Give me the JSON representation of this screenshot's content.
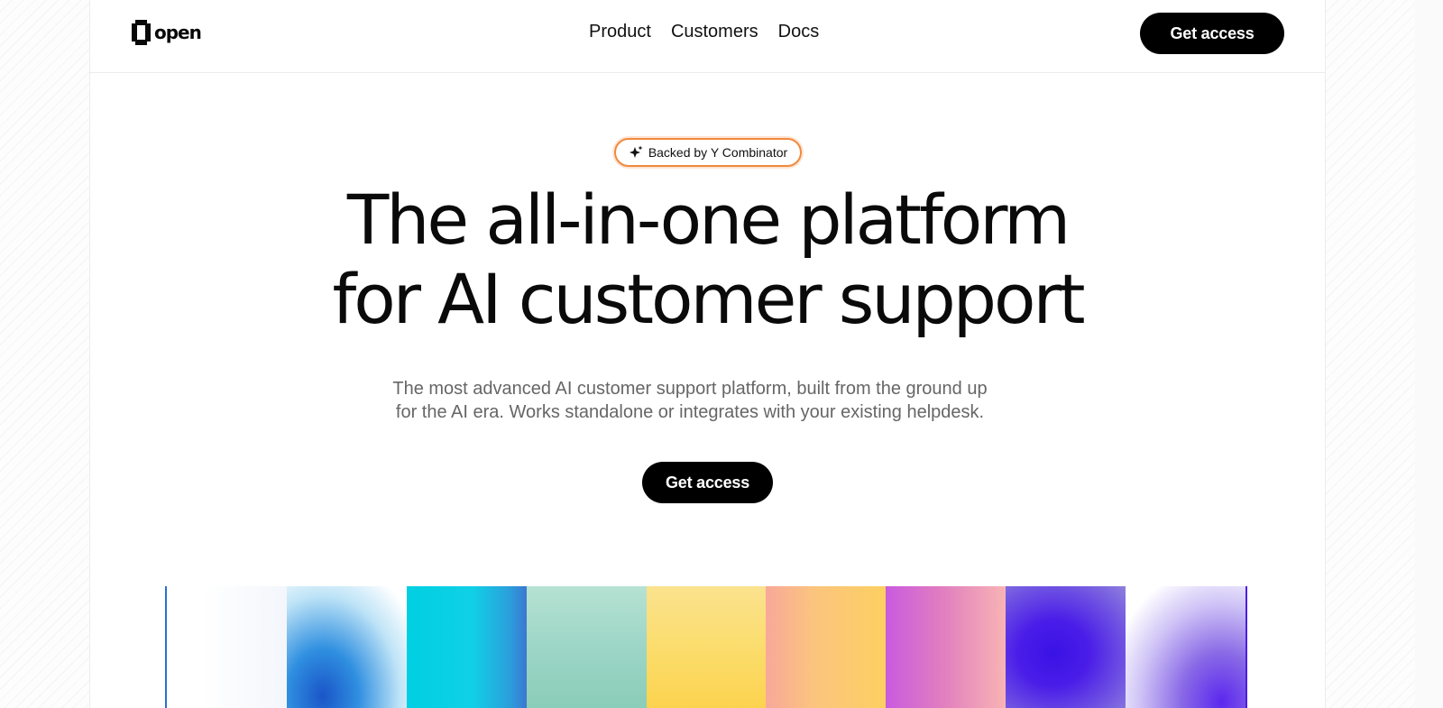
{
  "header": {
    "logo": {
      "icon": "open-logo-icon",
      "text": "open"
    },
    "nav": [
      {
        "label": "Product"
      },
      {
        "label": "Customers"
      },
      {
        "label": "Docs"
      }
    ],
    "cta_label": "Get access"
  },
  "hero": {
    "badge": {
      "icon": "sparkle-icon",
      "label": "Backed by Y Combinator",
      "border_color": "#f08a3e"
    },
    "headline_line1": "The all-in-one platform",
    "headline_line2": "for AI customer support",
    "subtitle_line1": "The most advanced AI customer support platform, built from the ground up",
    "subtitle_line2": "for the AI era. Works standalone or integrates with your existing helpdesk.",
    "cta_label": "Get access"
  },
  "colors": {
    "primary_button": "#000000",
    "primary_button_text": "#ffffff",
    "subtitle_text": "#666666",
    "badge_accent": "#f08a3e"
  }
}
